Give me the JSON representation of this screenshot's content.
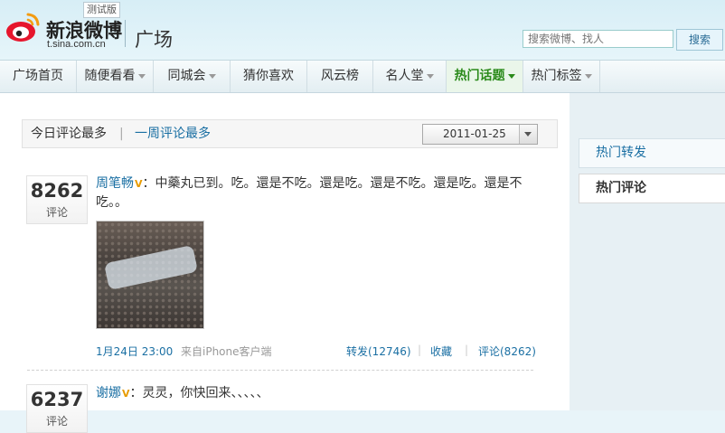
{
  "header": {
    "brand": "新浪微博",
    "brand_url": "t.sina.com.cn",
    "beta_badge": "测试版",
    "page_name": "广场",
    "search_placeholder": "搜索微博、找人",
    "search_button": "搜索"
  },
  "nav": {
    "items": [
      {
        "label": "广场首页"
      },
      {
        "label": "随便看看"
      },
      {
        "label": "同城会"
      },
      {
        "label": "猜你喜欢"
      },
      {
        "label": "风云榜"
      },
      {
        "label": "名人堂"
      },
      {
        "label": "热门话题"
      },
      {
        "label": "热门标签"
      }
    ],
    "active": "热门话题"
  },
  "filter": {
    "today_label": "今日评论最多",
    "separator": "|",
    "week_label": "一周评论最多",
    "date_value": "2011-01-25"
  },
  "posts": [
    {
      "count": "8262",
      "count_label": "评论",
      "author": "周笔畅",
      "verified": "V",
      "text": "：中藥丸已到。吃。還是不吃。還是吃。還是不吃。還是吃。還是不吃。。",
      "time": "1月24日 23:00",
      "source": "来自iPhone客户端",
      "repost": "转发(12746)",
      "favorite": "收藏",
      "comments": "评论(8262)"
    },
    {
      "count": "6237",
      "count_label": "评论",
      "author": "谢娜",
      "verified": "V",
      "text": "：灵灵，你快回来、、、、、"
    }
  ],
  "sidebar": {
    "tabs": [
      {
        "label": "热门转发"
      },
      {
        "label": "热门评论"
      }
    ],
    "active": "热门评论"
  },
  "colors": {
    "link": "#1a6fa3",
    "active_nav": "#2a8a1a",
    "verified": "#e79b00"
  }
}
